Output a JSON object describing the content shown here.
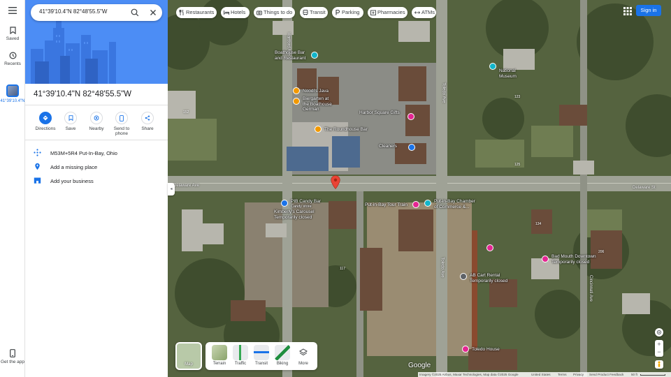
{
  "rail": {
    "saved": "Saved",
    "recents": "Recents",
    "recent_place": "41°39'10.4\"N",
    "get_app": "Get the app"
  },
  "search": {
    "value": "41°39'10.4\"N 82°48'55.5\"W"
  },
  "place": {
    "title": "41°39'10.4\"N 82°48'55.5\"W",
    "actions": [
      "Directions",
      "Save",
      "Nearby",
      "Send to phone",
      "Share"
    ],
    "plus_code": "M53M+5R4 Put-In-Bay, Ohio",
    "add_place": "Add a missing place",
    "add_business": "Add your business"
  },
  "chips": [
    "Restaurants",
    "Hotels",
    "Things to do",
    "Transit",
    "Parking",
    "Pharmacies",
    "ATMs"
  ],
  "header": {
    "sign_in": "Sign in"
  },
  "map": {
    "streets": [
      "Hartford Ave",
      "Toledo Ave",
      "Delaware Ave",
      "Delaware St",
      "Concord Ave",
      "Catawba Ave",
      "Cincinnati Ave"
    ],
    "pois": {
      "boathouse": "Boathouse Bar\nand Restaurant",
      "noodles": "Noodi's Java",
      "bierhaus": "Biergarten at\nthe Boathouse\nGerman",
      "harbor": "Harbor Square Gifts",
      "roundhouse": "The Roundhouse Bar",
      "cleaners": "Cleaners",
      "pib": "PIB Candy Bar",
      "candy": "Candy store",
      "carousel": "Kimberly's Carousel\nTemporarily closed",
      "train": "Put-in-Bay Tour Train",
      "chamber": "Put-in-Bay Chamber\nof Commerce &...",
      "downtown": "Bad Mouth Downtown\nTemporarily closed",
      "ab_car": "AB Cart Rental\nTemporarily closed",
      "toledo_house": "Toledo House",
      "national": "National\nMuseum"
    },
    "numbers": [
      "152",
      "123",
      "125",
      "134",
      "164",
      "117",
      "160",
      "104",
      "156",
      "92",
      "206",
      "148"
    ]
  },
  "layers": {
    "map_label": "Map",
    "items": [
      "Terrain",
      "Traffic",
      "Transit",
      "Biking",
      "More"
    ]
  },
  "brand": "Google",
  "footer": {
    "imagery": "Imagery ©2025 Airbus, Maxar Technologies, Map data ©2025 Google",
    "region": "United States",
    "terms": "Terms",
    "privacy": "Privacy",
    "feedback": "Send Product Feedback",
    "scale": "50 ft"
  },
  "colors": {
    "accent": "#1a73e8",
    "hero": "#4c8df5",
    "pin": "#ea4335"
  }
}
